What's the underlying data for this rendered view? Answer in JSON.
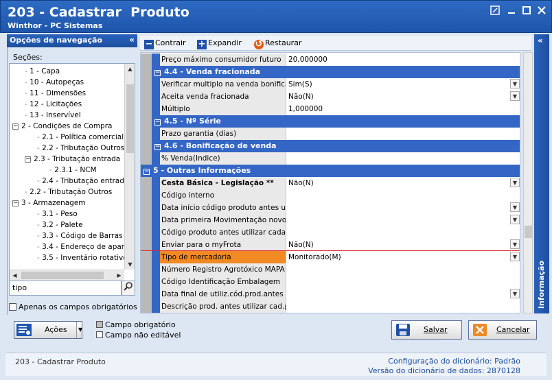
{
  "window": {
    "title": "203 - Cadastrar  Produto",
    "subtitle": "Winthor - PC Sistemas"
  },
  "nav": {
    "header": "Opções de navegação",
    "sections_label": "Seções:",
    "tree": [
      {
        "label": "1 - Capa",
        "level": 1,
        "toggle": ""
      },
      {
        "label": "10 - Autopeças",
        "level": 1,
        "toggle": ""
      },
      {
        "label": "11 - Dimensões",
        "level": 1,
        "toggle": ""
      },
      {
        "label": "12 - Licitações",
        "level": 1,
        "toggle": ""
      },
      {
        "label": "13 - Inservível",
        "level": 1,
        "toggle": ""
      },
      {
        "label": "2 - Condições de Compra",
        "level": 0,
        "toggle": "−"
      },
      {
        "label": "2.1 - Política comercial comp",
        "level": 2,
        "toggle": ""
      },
      {
        "label": "2.2 - Tributação Outros",
        "level": 2,
        "toggle": ""
      },
      {
        "label": "2.3 - Tributação entrada",
        "level": 1,
        "toggle": "−"
      },
      {
        "label": "2.3.1 - NCM",
        "level": 3,
        "toggle": ""
      },
      {
        "label": "2.4 - Tributação entrada In",
        "level": 2,
        "toggle": ""
      },
      {
        "label": "2.2 - Tributação Outros",
        "level": 1,
        "toggle": ""
      },
      {
        "label": "3 - Armazenagem",
        "level": 0,
        "toggle": "−"
      },
      {
        "label": "3.1 - Peso",
        "level": 2,
        "toggle": ""
      },
      {
        "label": "3.2 - Palete",
        "level": 2,
        "toggle": ""
      },
      {
        "label": "3.3 - Código de Barras",
        "level": 2,
        "toggle": ""
      },
      {
        "label": "3.4 - Endereço de apanha",
        "level": 2,
        "toggle": ""
      },
      {
        "label": "3.5 - Inventário rotativo",
        "level": 2,
        "toggle": ""
      }
    ],
    "search_value": "tipo",
    "required_only_label": "Apenas os campos obrigatórios"
  },
  "toolbar": {
    "collapse_label": "Contrair",
    "expand_label": "Expandir",
    "restore_label": "Restaurar"
  },
  "grid": {
    "rows": [
      {
        "kind": "prop",
        "name": "Preço máximo consumidor futuro",
        "value": "20,000000",
        "dropdown": false,
        "bold": false
      },
      {
        "kind": "cat",
        "name": "4.4 - Venda fracionada"
      },
      {
        "kind": "prop",
        "name": "Verificar multiplo na venda bonifica",
        "value": "Sim(S)",
        "dropdown": true,
        "bold": false
      },
      {
        "kind": "prop",
        "name": "Aceita venda fracionada",
        "value": "Não(N)",
        "dropdown": true,
        "bold": false
      },
      {
        "kind": "prop",
        "name": "Múltiplo",
        "value": "1,000000",
        "dropdown": false,
        "bold": false
      },
      {
        "kind": "cat",
        "name": "4.5 - Nº Série"
      },
      {
        "kind": "prop",
        "name": "Prazo garantia (dias)",
        "value": "",
        "dropdown": false,
        "bold": false
      },
      {
        "kind": "cat",
        "name": "4.6 - Bonificação de venda"
      },
      {
        "kind": "prop",
        "name": "% Venda(Indice)",
        "value": "",
        "dropdown": false,
        "bold": false
      },
      {
        "kind": "cat",
        "name": "5 - Outras Informações",
        "top": true
      },
      {
        "kind": "prop",
        "name": "Cesta Básica - Legislação **",
        "value": "Não(N)",
        "dropdown": true,
        "bold": true
      },
      {
        "kind": "prop",
        "name": "Código interno",
        "value": "",
        "dropdown": false,
        "bold": false
      },
      {
        "kind": "prop",
        "name": "Data início código produto antes utiliz",
        "value": "",
        "dropdown": true,
        "bold": false
      },
      {
        "kind": "prop",
        "name": "Data primeira Movimentação novo cód",
        "value": "",
        "dropdown": true,
        "bold": false
      },
      {
        "kind": "prop",
        "name": "Código produto antes utilizar cadastr",
        "value": "",
        "dropdown": false,
        "bold": false
      },
      {
        "kind": "prop",
        "name": "Enviar para o myFrota",
        "value": "Não(N)",
        "dropdown": true,
        "bold": false
      },
      {
        "kind": "prop",
        "name": "Tipo de mercadoria",
        "value": "Monitorado(M)",
        "dropdown": true,
        "bold": false,
        "highlight": true
      },
      {
        "kind": "prop",
        "name": "Número Registro Agrotóxico MAPA",
        "value": "",
        "dropdown": false,
        "bold": false
      },
      {
        "kind": "prop",
        "name": "Código Identificação Embalagem",
        "value": "",
        "dropdown": false,
        "bold": false
      },
      {
        "kind": "prop",
        "name": "Data final de utiliz.cód.prod.antes de",
        "value": "",
        "dropdown": true,
        "bold": false
      },
      {
        "kind": "prop",
        "name": "Descrição prod. antes utilizar cad.proc",
        "value": "",
        "dropdown": false,
        "bold": false
      }
    ]
  },
  "info_strip": {
    "label": "Informação"
  },
  "footer": {
    "actions_label": "Ações",
    "legend_required": "Campo obrigatório",
    "legend_not_editable": "Campo não editável",
    "save_label": "Salvar",
    "cancel_label": "Cancelar"
  },
  "status": {
    "left": "203 - Cadastrar  Produto",
    "config_label": "Configuração do dicionário:",
    "config_value": "Padrão",
    "version_label": "Versão do dicionário de dados:",
    "version_value": "2870128"
  },
  "colors": {
    "accent": "#3466c5",
    "highlight_cell": "#f28a23",
    "highlight_border": "#d9242a"
  }
}
